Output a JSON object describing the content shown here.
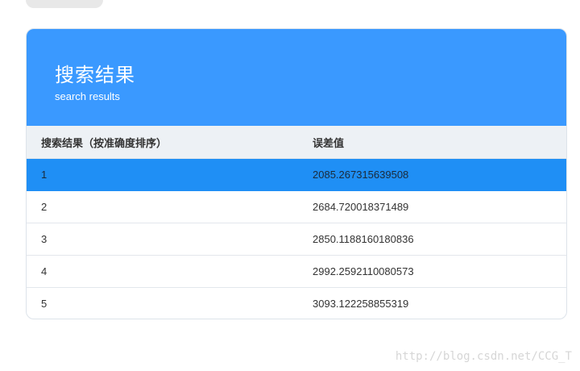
{
  "header": {
    "title": "搜索结果",
    "subtitle": "search results"
  },
  "table": {
    "columns": [
      "搜索结果（按准确度排序）",
      "误差值"
    ],
    "rows": [
      {
        "rank": "1",
        "error": "2085.267315639508"
      },
      {
        "rank": "2",
        "error": "2684.720018371489"
      },
      {
        "rank": "3",
        "error": "2850.1188160180836"
      },
      {
        "rank": "4",
        "error": "2992.2592110080573"
      },
      {
        "rank": "5",
        "error": "3093.122258855319"
      }
    ],
    "selected_row": 1
  },
  "watermark": "http://blog.csdn.net/CCG_T",
  "colors": {
    "header_bg": "#3a99ff",
    "selected_row_bg": "#1f8ff5",
    "table_header_bg": "#edf1f5"
  }
}
